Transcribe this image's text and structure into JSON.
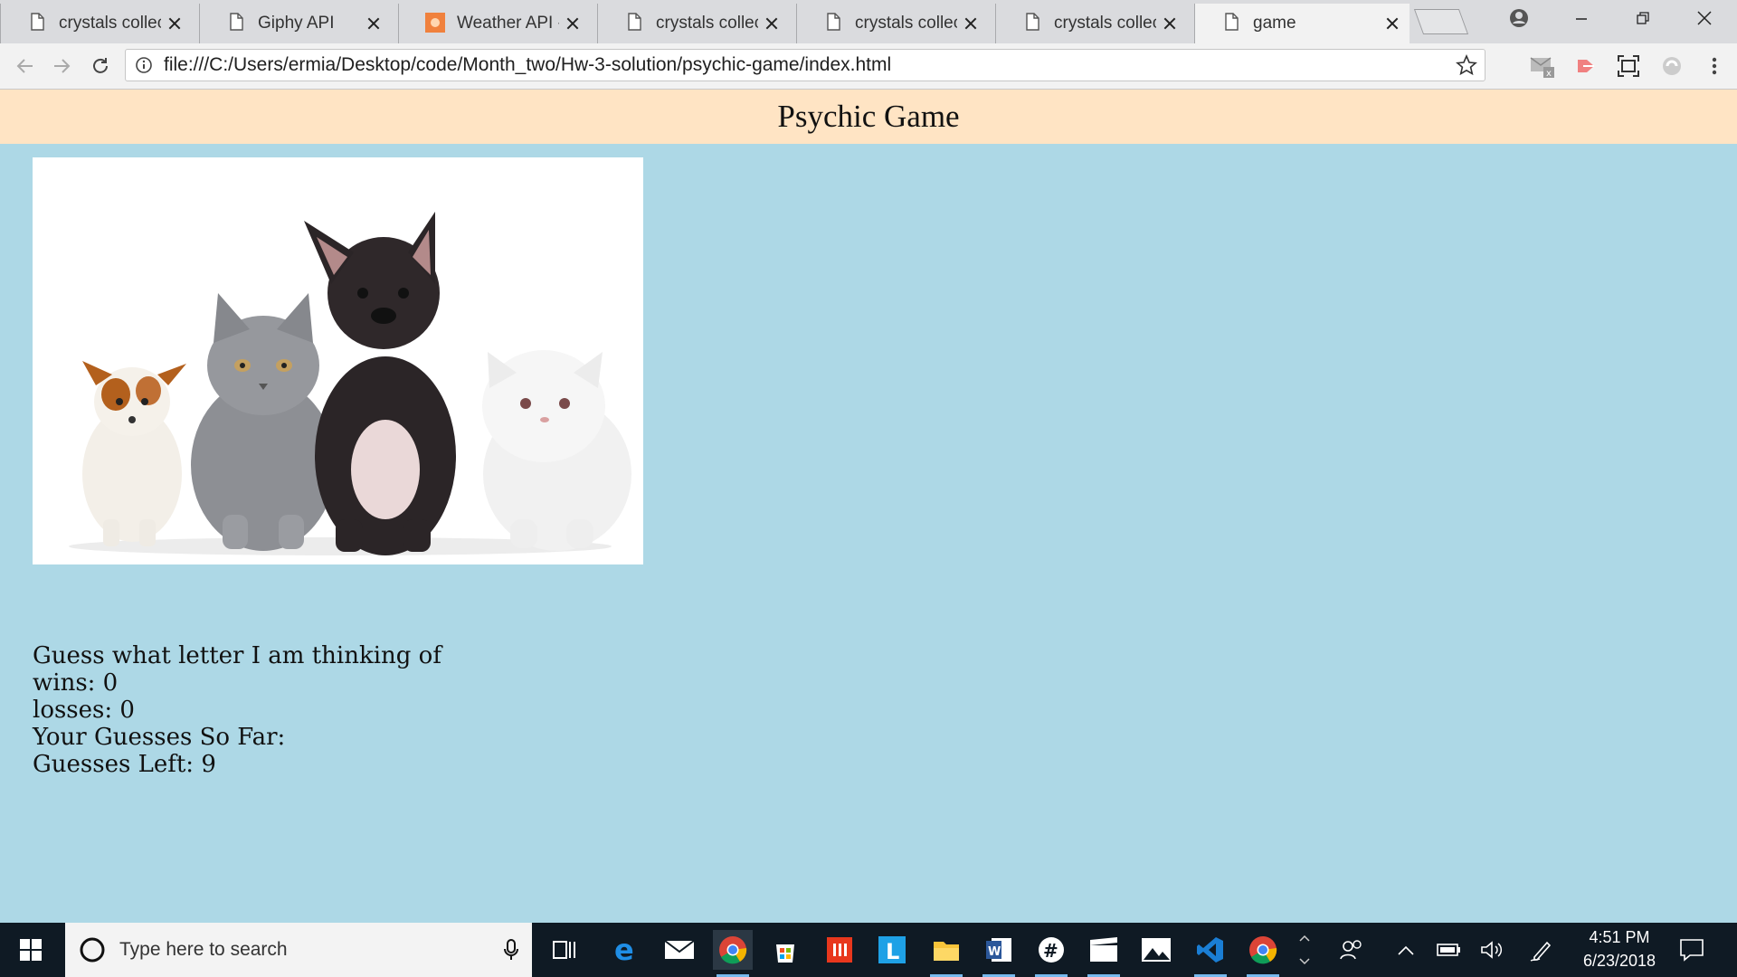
{
  "browser": {
    "tabs": [
      {
        "title": "crystals collector",
        "icon": "page-icon",
        "active": false
      },
      {
        "title": "Giphy API",
        "icon": "page-icon",
        "active": false
      },
      {
        "title": "Weather API - O",
        "icon": "weather-favicon",
        "active": false
      },
      {
        "title": "crystals collector",
        "icon": "page-icon",
        "active": false
      },
      {
        "title": "crystals collector",
        "icon": "page-icon",
        "active": false
      },
      {
        "title": "crystals collector",
        "icon": "page-icon",
        "active": false
      },
      {
        "title": "game",
        "icon": "page-icon",
        "active": true
      }
    ],
    "address": "file:///C:/Users/ermia/Desktop/code/Month_two/Hw-3-solution/psychic-game/index.html",
    "colors": {
      "tabstrip": "#dadbde",
      "toolbar": "#f2f2f2"
    }
  },
  "page": {
    "header_title": "Psychic Game",
    "header_bg": "#ffe4c4",
    "body_bg": "#add8e6",
    "image": "puppies-and-kittens-photo",
    "prompt": "Guess what letter I am thinking of",
    "wins_label": "wins: 0",
    "losses_label": "losses: 0",
    "guesses_so_far_label": "Your Guesses So Far:",
    "guesses_left_label": "Guesses Left: 9"
  },
  "taskbar": {
    "search_placeholder": "Type here to search",
    "time": "4:51 PM",
    "date": "6/23/2018",
    "apps": [
      "task-view-icon",
      "edge-icon",
      "mail-icon",
      "chrome-icon",
      "store-icon",
      "office-icon",
      "l-app-icon",
      "file-explorer-icon",
      "word-icon",
      "slack-icon",
      "movies-icon",
      "photos-icon",
      "vscode-icon",
      "chrome-icon"
    ]
  }
}
